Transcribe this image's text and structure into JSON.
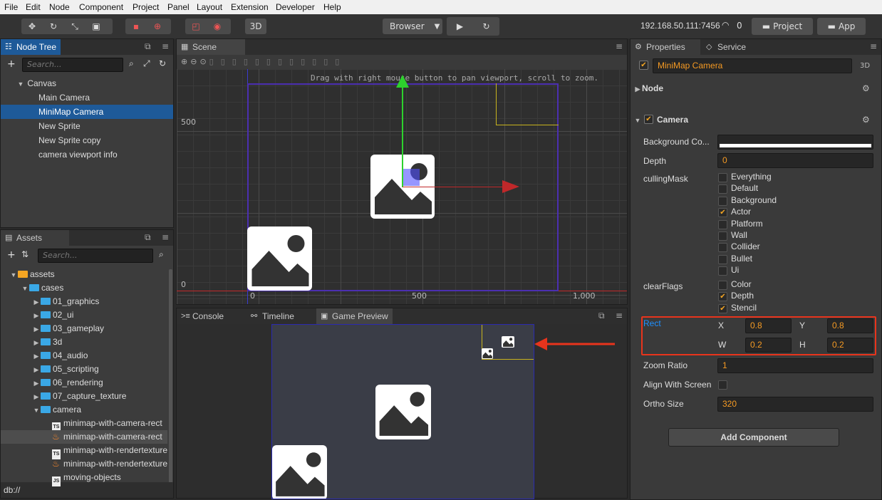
{
  "menu": [
    "File",
    "Edit",
    "Node",
    "Component",
    "Project",
    "Panel",
    "Layout",
    "Extension",
    "Developer",
    "Help"
  ],
  "toolbar": {
    "mode_3d": "3D",
    "browser": "Browser",
    "browser_arrow": "▼",
    "ip": "192.168.50.111:7456",
    "wifi_count": "0",
    "project_btn": "Project",
    "app_btn": "App"
  },
  "node_tree": {
    "tab": "Node Tree",
    "search_placeholder": "Search...",
    "items": [
      "Canvas",
      "Main Camera",
      "MiniMap Camera",
      "New Sprite",
      "New Sprite copy",
      "camera viewport info"
    ]
  },
  "assets": {
    "tab": "Assets",
    "search_placeholder": "Search...",
    "root": "assets",
    "cases": "cases",
    "folders": [
      "01_graphics",
      "02_ui",
      "03_gameplay",
      "3d",
      "04_audio",
      "05_scripting",
      "06_rendering",
      "07_capture_texture",
      "camera"
    ],
    "files": [
      {
        "name": "minimap-with-camera-rect",
        "type": "TS"
      },
      {
        "name": "minimap-with-camera-rect",
        "type": "fire"
      },
      {
        "name": "minimap-with-rendertexture",
        "type": "TS"
      },
      {
        "name": "minimap-with-rendertexture",
        "type": "fire"
      },
      {
        "name": "moving-objects",
        "type": "JS"
      }
    ],
    "footer": "db://"
  },
  "scene": {
    "tab": "Scene",
    "hint": "Drag with right mouse button to pan viewport, scroll to zoom.",
    "y_labels": [
      "500",
      "0"
    ],
    "x_labels": [
      "0",
      "500",
      "1,000"
    ]
  },
  "bottom_tabs": {
    "console": "Console",
    "timeline": "Timeline",
    "game_preview": "Game Preview"
  },
  "properties": {
    "tab": "Properties",
    "service_tab": "Service",
    "node_name": "MiniMap Camera",
    "badge_3d": "3D",
    "node_section": "Node",
    "camera_section": "Camera",
    "background_color_label": "Background Co...",
    "depth_label": "Depth",
    "depth_value": "0",
    "culling_label": "cullingMask",
    "culling_items": [
      {
        "label": "Everything",
        "checked": false
      },
      {
        "label": "Default",
        "checked": false
      },
      {
        "label": "Background",
        "checked": false
      },
      {
        "label": "Actor",
        "checked": true
      },
      {
        "label": "Platform",
        "checked": false
      },
      {
        "label": "Wall",
        "checked": false
      },
      {
        "label": "Collider",
        "checked": false
      },
      {
        "label": "Bullet",
        "checked": false
      },
      {
        "label": "Ui",
        "checked": false
      }
    ],
    "clear_label": "clearFlags",
    "clear_items": [
      {
        "label": "Color",
        "checked": false
      },
      {
        "label": "Depth",
        "checked": true
      },
      {
        "label": "Stencil",
        "checked": true
      }
    ],
    "rect_label": "Rect",
    "rect": {
      "x_label": "X",
      "x": "0.8",
      "y_label": "Y",
      "y": "0.8",
      "w_label": "W",
      "w": "0.2",
      "h_label": "H",
      "h": "0.2"
    },
    "zoom_label": "Zoom Ratio",
    "zoom_value": "1",
    "align_label": "Align With Screen",
    "ortho_label": "Ortho Size",
    "ortho_value": "320",
    "add_component": "Add Component"
  },
  "colors": {
    "accent": "#f59a23",
    "selection": "#1e5a99",
    "highlight": "#e8341c",
    "link": "#1e90ff"
  }
}
